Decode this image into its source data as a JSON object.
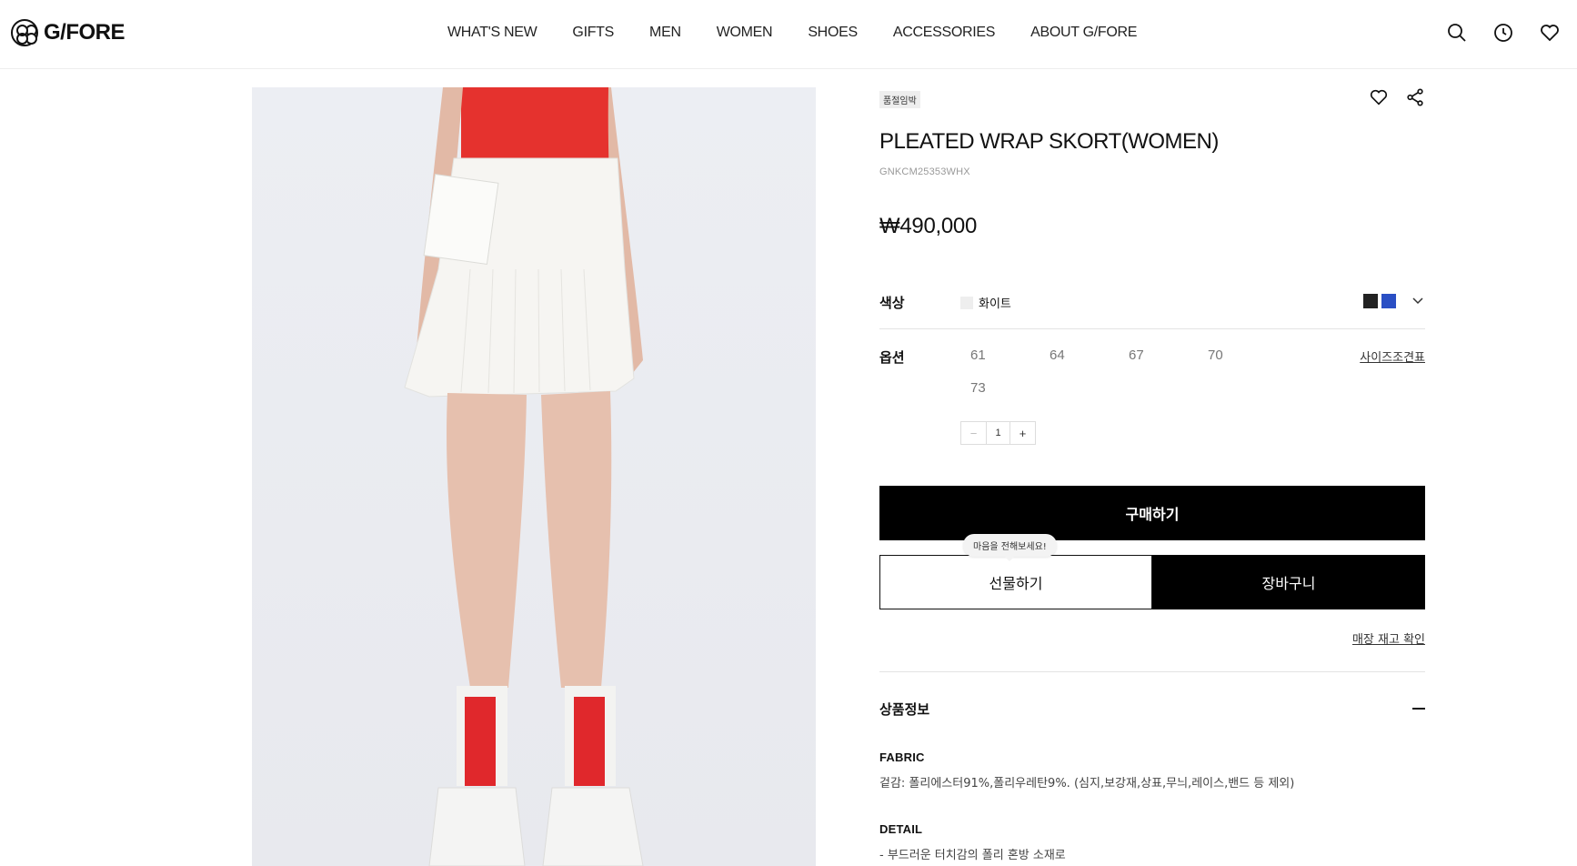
{
  "brand": {
    "logo_text": "G/FORE"
  },
  "nav": {
    "items": [
      "WHAT'S NEW",
      "GIFTS",
      "MEN",
      "WOMEN",
      "SHOES",
      "ACCESSORIES",
      "ABOUT G/FORE"
    ]
  },
  "header_icons": [
    "search-icon",
    "history-clock-icon",
    "wishlist-heart-icon"
  ],
  "product": {
    "badge": "품절임박",
    "title": "PLEATED WRAP SKORT(WOMEN)",
    "sku": "GNKCM25353WHX",
    "price": "₩490,000",
    "color_label": "색상",
    "color_value": "화이트",
    "color_swatches": [
      {
        "name": "black",
        "hex": "#222222"
      },
      {
        "name": "blue",
        "hex": "#2a4fc4"
      }
    ],
    "current_swatch_hex": "#eeeeee",
    "option_label": "옵션",
    "sizes": [
      "61",
      "64",
      "67",
      "70",
      "73"
    ],
    "size_guide": "사이즈조견표",
    "quantity": {
      "minus": "−",
      "value": "1",
      "plus": "+"
    },
    "buy_label": "구매하기",
    "gift_label": "선물하기",
    "cart_label": "장바구니",
    "gift_tooltip": "마음을 전해보세요!",
    "store_stock_link": "매장 재고 확인",
    "info_section_title": "상품정보",
    "fabric_heading": "FABRIC",
    "fabric_text": "겉감: 폴리에스터91%,폴리우레탄9%. (심지,보강재,상표,무늬,레이스,밴드 등 제외)",
    "detail_heading": "DETAIL",
    "detail_text": "- 부드러운 터치감의 폴리 혼방 소재로"
  },
  "colors": {
    "top_red": "#e5322e",
    "sock_red": "#e0282c",
    "skirt_white": "#f6f5f2"
  }
}
